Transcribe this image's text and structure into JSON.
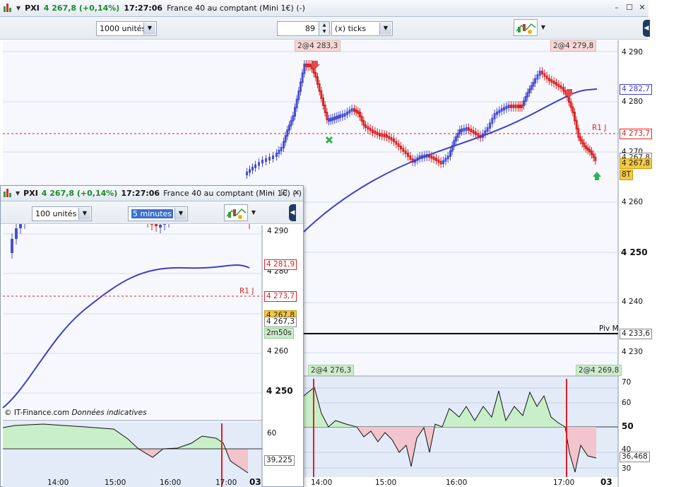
{
  "main": {
    "symbol": "PXI",
    "price_change": "4 267,8 (+0,14%)",
    "time": "17:27:06",
    "instrument": "France 40 au comptant (Mini 1€) (-)",
    "quantity": "1000 unités",
    "period_value": "89",
    "period_unit": "(x) ticks",
    "price_axis": [
      "4 290",
      "4 280",
      "4 270",
      "4 260",
      "4 250",
      "4 240",
      "4 230"
    ],
    "price_axis_bold": "4 250",
    "boxes": {
      "ma": "4 282,7",
      "r1": "4 273,7",
      "last_a": "4 267,8",
      "last_b": "4 267,8",
      "ticks": "8T",
      "piv": "4 233,6"
    },
    "labels": {
      "r1": "R1 J",
      "piv": "Piv M"
    },
    "tags_top": [
      "2@4 283,3",
      "2@4 279,8"
    ],
    "tags_osc": [
      "2@4 276,3",
      "2@4 269,8"
    ],
    "osc_axis": [
      "70",
      "60",
      "50",
      "40",
      "30"
    ],
    "osc_box": "36,468",
    "time_axis": [
      "14:00",
      "15:00",
      "16:00",
      "17:00",
      "03"
    ]
  },
  "sub": {
    "symbol": "PXI",
    "price_change": "4 267,8 (+0,14%)",
    "time": "17:27:06",
    "instrument": "France 40 au comptant (Mini 1€) (-)",
    "quantity": "100 unités",
    "period": "5 minutes",
    "price_axis": [
      "4 290",
      "4 280",
      "4 270",
      "4 260",
      "4 250"
    ],
    "boxes": {
      "ma": "4 281,9",
      "r1": "4 273,7",
      "last": "4 267,8",
      "close": "4 267,3",
      "timer": "2m50s"
    },
    "r1_label": "R1 J",
    "credit": "© IT-Finance.com",
    "credit_note": "Données indicatives",
    "osc_axis": [
      "60"
    ],
    "osc_box": "39,225",
    "time_axis": [
      "14:00",
      "15:00",
      "16:00",
      "17:00",
      "03"
    ]
  },
  "colors": {
    "up": "#4a4fcf",
    "down": "#d92626",
    "ma": "#3f3fc9",
    "osc_up_fill": "#c9efc9",
    "osc_down_fill": "#f2c4cc",
    "osc_bg": "#e3ebf9",
    "price_bg": "#f6f8fd"
  }
}
